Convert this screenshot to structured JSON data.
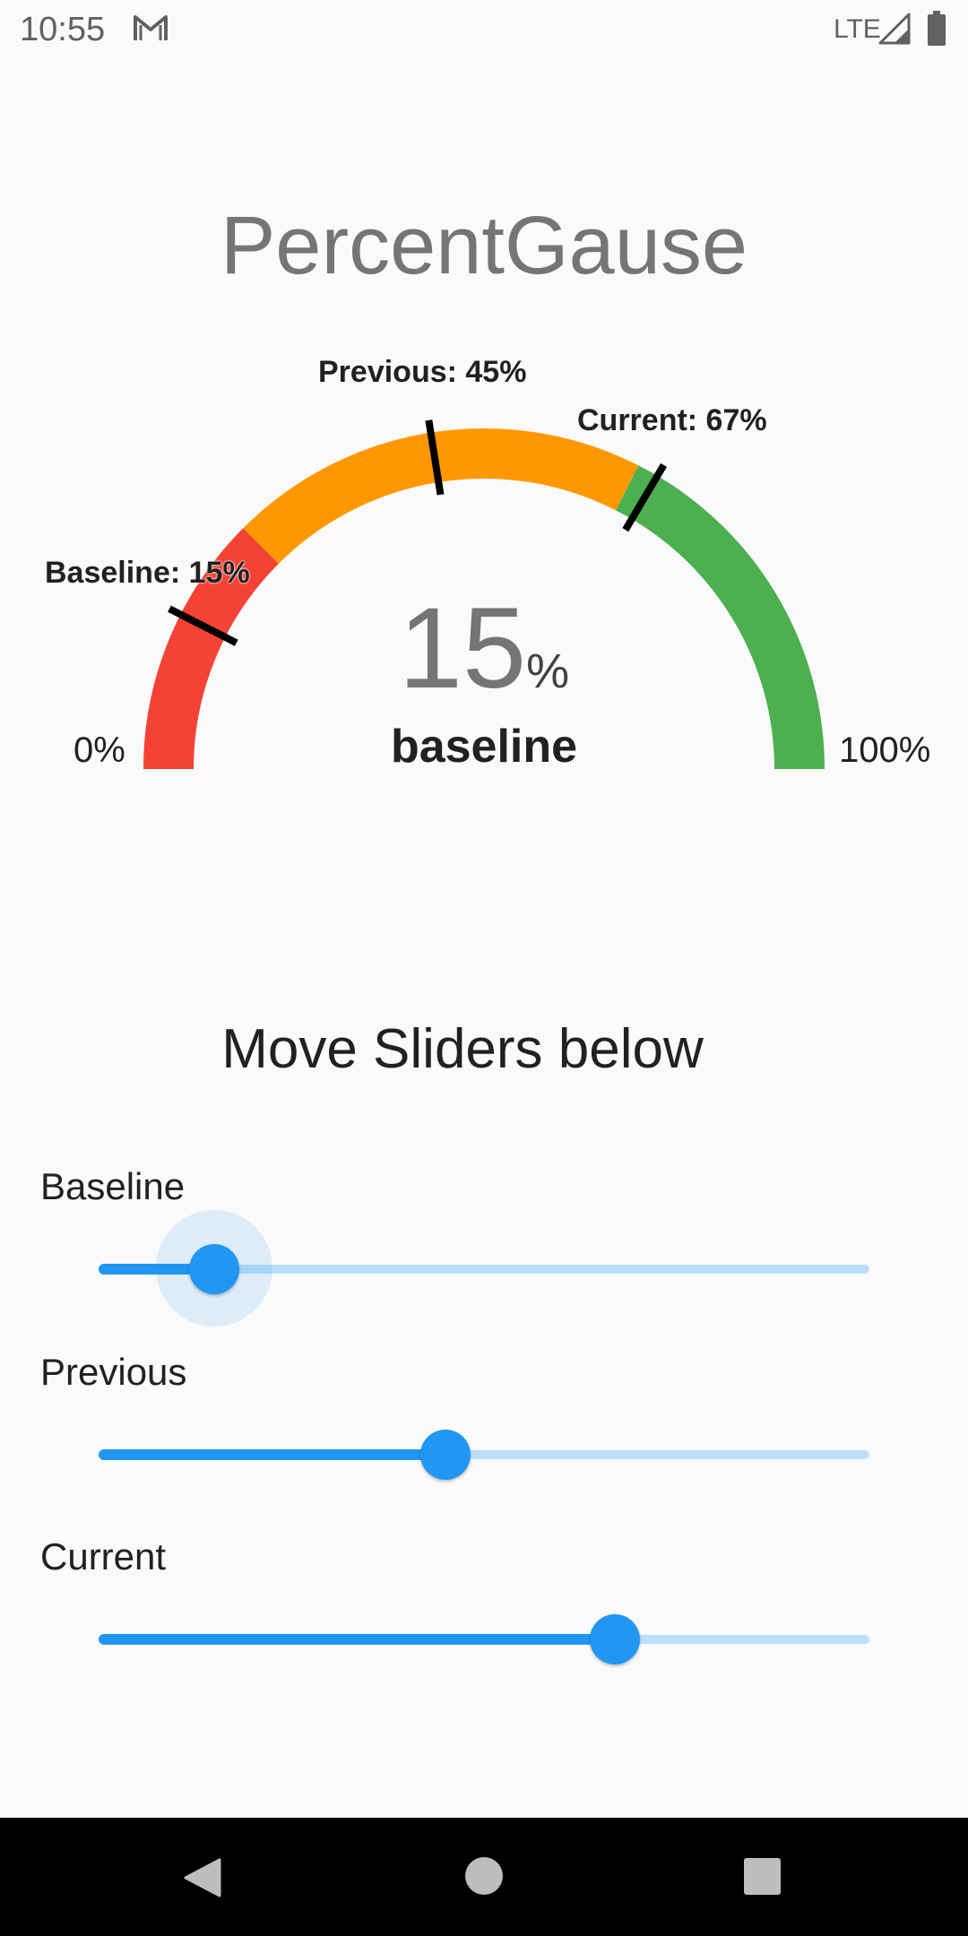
{
  "status_bar": {
    "time": "10:55",
    "network": "LTE",
    "icons": [
      "gmail-icon",
      "signal-icon",
      "battery-icon"
    ]
  },
  "app": {
    "title": "PercentGause"
  },
  "gauge": {
    "value_percent": 15,
    "value_number": "15",
    "value_unit": "%",
    "caption": "baseline",
    "min_label": "0%",
    "max_label": "100%",
    "bands": [
      {
        "from": 0,
        "to": 25,
        "color": "#f44336"
      },
      {
        "from": 25,
        "to": 65,
        "color": "#ff9800"
      },
      {
        "from": 65,
        "to": 100,
        "color": "#4caf50"
      }
    ],
    "markers": [
      {
        "key": "baseline",
        "value": 15,
        "label": "Baseline: 15%"
      },
      {
        "key": "previous",
        "value": 45,
        "label": "Previous: 45%"
      },
      {
        "key": "current",
        "value": 67,
        "label": "Current: 67%"
      }
    ]
  },
  "sliders": {
    "heading": "Move Sliders below",
    "items": [
      {
        "key": "baseline",
        "label": "Baseline",
        "value": 15,
        "active": true
      },
      {
        "key": "previous",
        "label": "Previous",
        "value": 45,
        "active": false
      },
      {
        "key": "current",
        "label": "Current",
        "value": 67,
        "active": false
      }
    ],
    "accent_color": "#2196f3",
    "inactive_track_color": "#bbdefb"
  },
  "nav_bar": {
    "icons": [
      "back-icon",
      "home-icon",
      "recents-icon"
    ]
  }
}
